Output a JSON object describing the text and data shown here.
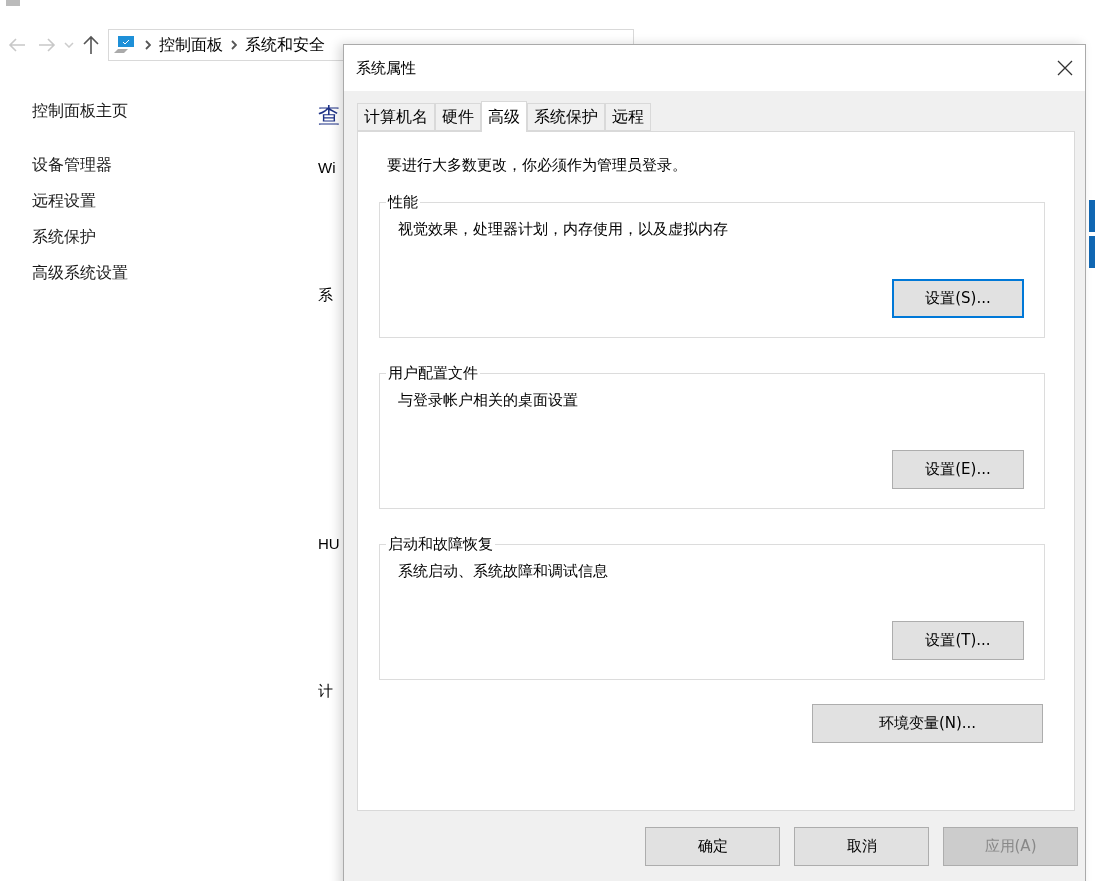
{
  "nav": {
    "back_disabled": true,
    "forward_disabled": true
  },
  "breadcrumb": [
    "控制面板",
    "系统和安全"
  ],
  "sidebar": {
    "home": "控制面板主页",
    "links": [
      "设备管理器",
      "远程设置",
      "系统保护",
      "高级系统设置"
    ]
  },
  "main_fragments": [
    {
      "text": "查",
      "kind": "heading"
    },
    {
      "text": "Wi",
      "kind": "text"
    },
    {
      "text": "系",
      "kind": "text"
    },
    {
      "text": "HU",
      "kind": "text"
    },
    {
      "text": "计",
      "kind": "text"
    }
  ],
  "dialog": {
    "title": "系统属性",
    "tabs": [
      {
        "label": "计算机名",
        "selected": false
      },
      {
        "label": "硬件",
        "selected": false
      },
      {
        "label": "高级",
        "selected": true
      },
      {
        "label": "系统保护",
        "selected": false
      },
      {
        "label": "远程",
        "selected": false
      }
    ],
    "notice": "要进行大多数更改，你必须作为管理员登录。",
    "groups": [
      {
        "title": "性能",
        "description": "视觉效果，处理器计划，内存使用，以及虚拟内存",
        "button": "设置(S)...",
        "focused": true
      },
      {
        "title": "用户配置文件",
        "description": "与登录帐户相关的桌面设置",
        "button": "设置(E)...",
        "focused": false
      },
      {
        "title": "启动和故障恢复",
        "description": "系统启动、系统故障和调试信息",
        "button": "设置(T)...",
        "focused": false
      }
    ],
    "env_button": "环境变量(N)...",
    "footer_buttons": [
      {
        "label": "确定",
        "disabled": false
      },
      {
        "label": "取消",
        "disabled": false
      },
      {
        "label": "应用(A)",
        "disabled": true
      }
    ]
  }
}
